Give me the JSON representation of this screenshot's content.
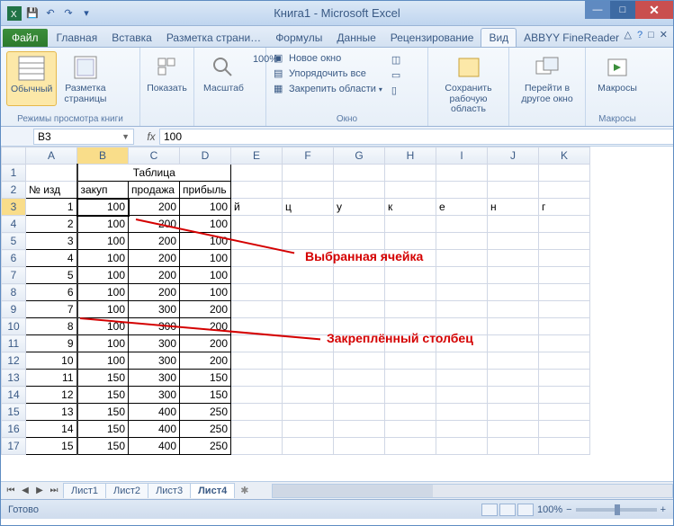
{
  "app_title": "Книга1 - Microsoft Excel",
  "file_tab": "Файл",
  "tabs": [
    "Главная",
    "Вставка",
    "Разметка страни…",
    "Формулы",
    "Данные",
    "Рецензирование",
    "Вид",
    "ABBYY FineReader"
  ],
  "active_tab_index": 6,
  "ribbon": {
    "group1_label": "Режимы просмотра книги",
    "btn_normal": "Обычный",
    "btn_pagelayout": "Разметка\nстраницы",
    "btn_show": "Показать",
    "btn_zoom": "Масштаб",
    "btn_100": "100%",
    "window_items": [
      "Новое окно",
      "Упорядочить все",
      "Закрепить области"
    ],
    "group_window_label": "Окно",
    "btn_save_ws": "Сохранить\nрабочую область",
    "btn_switch": "Перейти в\nдругое окно",
    "btn_macros": "Макросы",
    "group_macros_label": "Макросы"
  },
  "name_box": "B3",
  "formula_value": "100",
  "columns": [
    "A",
    "B",
    "C",
    "D",
    "E",
    "F",
    "G",
    "H",
    "I",
    "J",
    "K"
  ],
  "table_title": "Таблица",
  "headers": {
    "A": "№ изд",
    "B": "закуп",
    "C": "продажа",
    "D": "прибыль"
  },
  "chart_data": {
    "type": "table",
    "columns": [
      "№ изд",
      "закуп",
      "продажа",
      "прибыль"
    ],
    "rows": [
      [
        1,
        100,
        200,
        100
      ],
      [
        2,
        100,
        200,
        100
      ],
      [
        3,
        100,
        200,
        100
      ],
      [
        4,
        100,
        200,
        100
      ],
      [
        5,
        100,
        200,
        100
      ],
      [
        6,
        100,
        200,
        100
      ],
      [
        7,
        100,
        300,
        200
      ],
      [
        8,
        100,
        300,
        200
      ],
      [
        9,
        100,
        300,
        200
      ],
      [
        10,
        100,
        300,
        200
      ],
      [
        11,
        150,
        300,
        150
      ],
      [
        12,
        150,
        300,
        150
      ],
      [
        13,
        150,
        400,
        250
      ],
      [
        14,
        150,
        400,
        250
      ],
      [
        15,
        150,
        400,
        250
      ]
    ]
  },
  "row5_extras": {
    "E": "й",
    "F": "ц",
    "G": "у",
    "H": "к",
    "I": "е",
    "J": "н",
    "K": "г"
  },
  "annotations": {
    "sel_cell": "Выбранная ячейка",
    "frozen_col": "Закреплённый столбец"
  },
  "sheets": [
    "Лист1",
    "Лист2",
    "Лист3",
    "Лист4"
  ],
  "active_sheet_index": 3,
  "status_text": "Готово",
  "zoom": "100%"
}
